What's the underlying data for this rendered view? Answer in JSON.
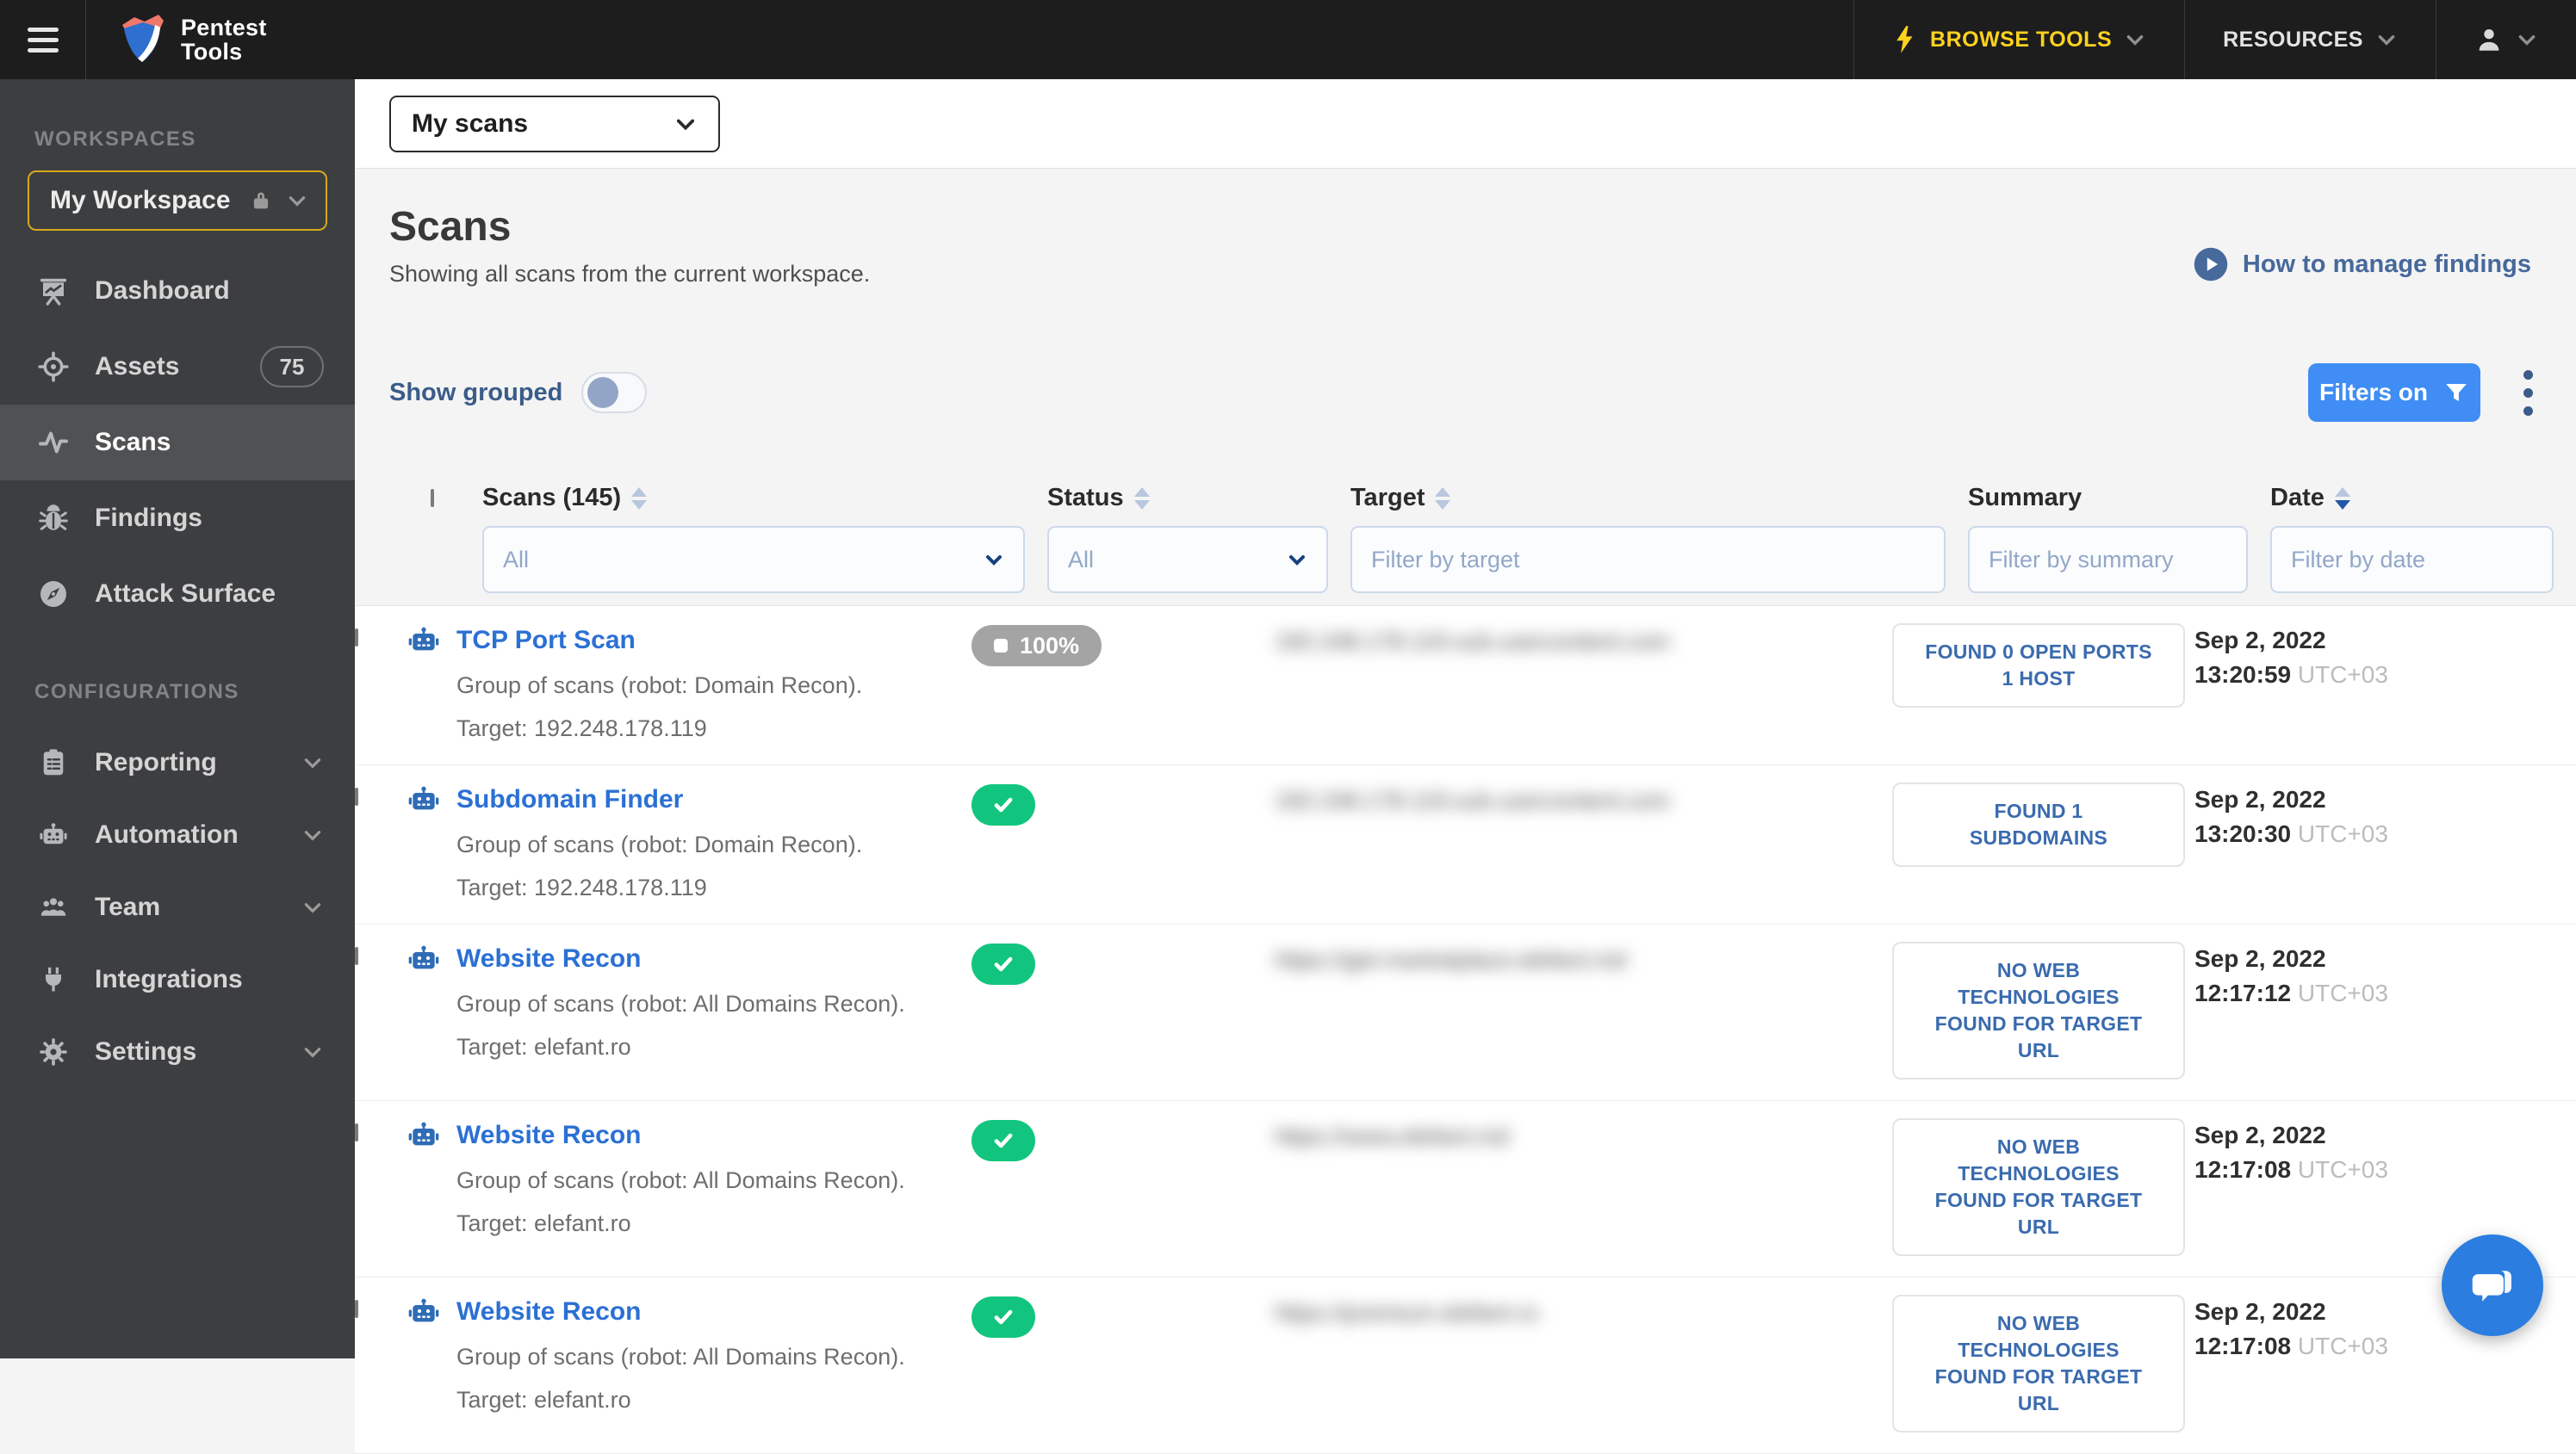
{
  "topbar": {
    "logo_line1": "Pentest",
    "logo_line2": "Tools",
    "browse_tools_label": "BROWSE TOOLS",
    "resources_label": "RESOURCES"
  },
  "sidebar": {
    "workspaces_label": "WORKSPACES",
    "workspace_name": "My Workspace",
    "nav": [
      {
        "label": "Dashboard",
        "icon": "presentation-chart-icon",
        "active": false
      },
      {
        "label": "Assets",
        "icon": "target-icon",
        "active": false,
        "badge": "75"
      },
      {
        "label": "Scans",
        "icon": "pulse-icon",
        "active": true
      },
      {
        "label": "Findings",
        "icon": "bug-icon",
        "active": false
      },
      {
        "label": "Attack Surface",
        "icon": "compass-icon",
        "active": false
      }
    ],
    "configurations_label": "CONFIGURATIONS",
    "config_nav": [
      {
        "label": "Reporting",
        "icon": "clipboard-icon",
        "chevron": true
      },
      {
        "label": "Automation",
        "icon": "robot-icon",
        "chevron": true
      },
      {
        "label": "Team",
        "icon": "team-icon",
        "chevron": true
      },
      {
        "label": "Integrations",
        "icon": "plug-icon",
        "chevron": false
      },
      {
        "label": "Settings",
        "icon": "gear-icon",
        "chevron": true
      }
    ]
  },
  "scope_bar": {
    "selected_value": "My scans"
  },
  "page": {
    "title": "Scans",
    "subtitle": "Showing all scans from the current workspace.",
    "help_link_label": "How to manage findings"
  },
  "controls": {
    "show_grouped_label": "Show grouped",
    "grouped_on": false,
    "filters_button_label": "Filters on"
  },
  "table": {
    "columns": [
      {
        "label": "Scans (145)",
        "sortable": true
      },
      {
        "label": "Status",
        "sortable": true
      },
      {
        "label": "Target",
        "sortable": true
      },
      {
        "label": "Summary",
        "sortable": false
      },
      {
        "label": "Date",
        "sortable": true,
        "sorted": "desc"
      }
    ],
    "filters": {
      "scan_type_value": "All",
      "status_value": "All",
      "target_placeholder": "Filter by target",
      "summary_placeholder": "Filter by summary",
      "date_placeholder": "Filter by date"
    },
    "rows": [
      {
        "name": "TCP Port Scan",
        "description": "Group of scans (robot: Domain Recon).",
        "target_note": "Target: 192.248.178.119",
        "status": {
          "type": "stopped",
          "label": "100%"
        },
        "target": {
          "redacted": true,
          "blur_text": "192.248.178.119.sub.usercontent.com"
        },
        "summary_lines": [
          "FOUND 0 OPEN PORTS",
          "1 HOST"
        ],
        "date": "Sep 2, 2022",
        "time": "13:20:59",
        "tz": "UTC+03"
      },
      {
        "name": "Subdomain Finder",
        "description": "Group of scans (robot: Domain Recon).",
        "target_note": "Target: 192.248.178.119",
        "status": {
          "type": "success",
          "label": ""
        },
        "target": {
          "redacted": true,
          "blur_text": "192.248.178.119.sub.usercontent.com"
        },
        "summary_lines": [
          "FOUND 1",
          "SUBDOMAINS"
        ],
        "date": "Sep 2, 2022",
        "time": "13:20:30",
        "tz": "UTC+03"
      },
      {
        "name": "Website Recon",
        "description": "Group of scans (robot: All Domains Recon).",
        "target_note": "Target: elefant.ro",
        "status": {
          "type": "success",
          "label": ""
        },
        "target": {
          "redacted": true,
          "blur_text": "https://get-marketplace.elefant.md"
        },
        "summary_lines": [
          "NO WEB",
          "TECHNOLOGIES",
          "FOUND FOR TARGET",
          "URL"
        ],
        "date": "Sep 2, 2022",
        "time": "12:17:12",
        "tz": "UTC+03"
      },
      {
        "name": "Website Recon",
        "description": "Group of scans (robot: All Domains Recon).",
        "target_note": "Target: elefant.ro",
        "status": {
          "type": "success",
          "label": ""
        },
        "target": {
          "redacted": true,
          "blur_text": "https://www.elefant.md"
        },
        "summary_lines": [
          "NO WEB",
          "TECHNOLOGIES",
          "FOUND FOR TARGET",
          "URL"
        ],
        "date": "Sep 2, 2022",
        "time": "12:17:08",
        "tz": "UTC+03"
      },
      {
        "name": "Website Recon",
        "description": "Group of scans (robot: All Domains Recon).",
        "target_note": "Target: elefant.ro",
        "status": {
          "type": "success",
          "label": ""
        },
        "target": {
          "redacted": true,
          "blur_text": "https://premium.elefant.ro"
        },
        "summary_lines": [
          "NO WEB",
          "TECHNOLOGIES",
          "FOUND FOR TARGET",
          "URL"
        ],
        "date": "Sep 2, 2022",
        "time": "12:17:08",
        "tz": "UTC+03"
      }
    ]
  },
  "icons": {
    "hamburger-icon": "three-bars",
    "shield-logo-icon": "brand-shield",
    "bolt-icon": "lightning",
    "chevron-down-icon": "v-chevron",
    "user-icon": "person-silhouette",
    "lock-icon": "padlock",
    "play-circle-icon": "play-in-circle",
    "filter-icon": "funnel",
    "kebab-icon": "three-dots-vertical",
    "sort-icon": "up-down-triangles",
    "robot-icon": "robot-head",
    "check-icon": "checkmark",
    "stop-icon": "white-square",
    "chat-icon": "speech-bubbles"
  },
  "colors": {
    "topbar_bg": "#1d1d1e",
    "sidebar_bg": "#3d3e40",
    "sidebar_active_bg": "#505153",
    "workspace_border": "#d7a91c",
    "brand_yellow": "#ffd21e",
    "page_bg": "#f4f4f5",
    "primary_blue": "#3f8df5",
    "link_blue": "#2b70d4",
    "steel_blue": "#47699b",
    "summary_blue": "#3a6bae",
    "success_green": "#12c57e",
    "stopped_gray": "#a4a4a4",
    "chat_blue": "#2b7de0"
  }
}
